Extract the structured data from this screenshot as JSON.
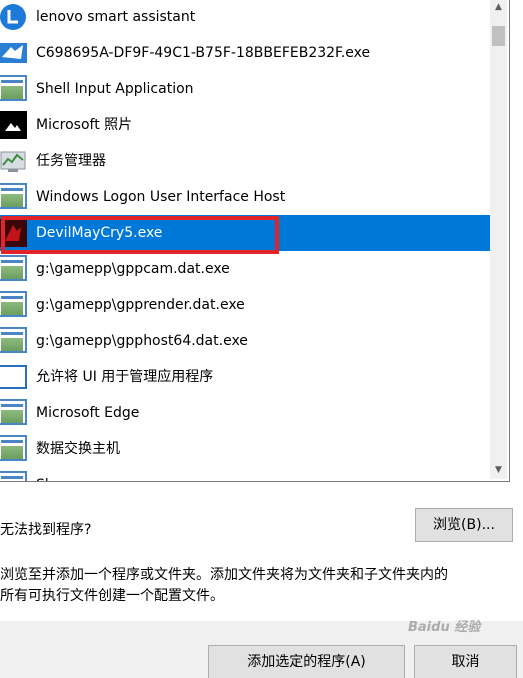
{
  "programs": [
    {
      "label": "lenovo smart assistant",
      "icon": "lenovo-assistant-icon"
    },
    {
      "label": "C698695A-DF9F-49C1-B75F-18BBEFEB232F.exe",
      "icon": "app-logo-icon"
    },
    {
      "label": "Shell Input Application",
      "icon": "window-app-icon"
    },
    {
      "label": "Microsoft 照片",
      "icon": "photos-icon"
    },
    {
      "label": "任务管理器",
      "icon": "task-manager-icon"
    },
    {
      "label": "Windows Logon User Interface Host",
      "icon": "window-app-icon"
    },
    {
      "label": "DevilMayCry5.exe",
      "icon": "game-icon",
      "selected": true
    },
    {
      "label": "g:\\gamepp\\gppcam.dat.exe",
      "icon": "window-app-icon"
    },
    {
      "label": "g:\\gamepp\\gpprender.dat.exe",
      "icon": "window-app-icon"
    },
    {
      "label": "g:\\gamepp\\gpphost64.dat.exe",
      "icon": "window-app-icon"
    },
    {
      "label": "允许将 UI 用于管理应用程序",
      "icon": "blank-window-icon"
    },
    {
      "label": "Microsoft Edge",
      "icon": "window-app-icon"
    },
    {
      "label": "数据交换主机",
      "icon": "window-app-icon"
    },
    {
      "label": "Sk",
      "icon": "window-app-icon"
    }
  ],
  "question": "无法找到程序?",
  "browse_label": "浏览(B)...",
  "description_line1": "浏览至并添加一个程序或文件夹。添加文件夹将为文件夹和子文件夹内的",
  "description_line2": "所有可执行文件创建一个配置文件。",
  "add_selected_label": "添加选定的程序(A)",
  "cancel_label": "取消",
  "watermark": "Baidu 经验",
  "colors": {
    "selection": "#0078d7",
    "highlight": "#e0242a"
  }
}
